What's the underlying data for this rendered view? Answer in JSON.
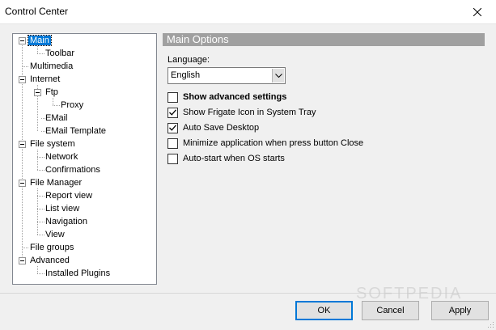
{
  "window": {
    "title": "Control Center"
  },
  "tree": {
    "items": [
      {
        "label": "Main",
        "selected": true
      },
      {
        "label": "Toolbar"
      },
      {
        "label": "Multimedia"
      },
      {
        "label": "Internet"
      },
      {
        "label": "Ftp"
      },
      {
        "label": "Proxy"
      },
      {
        "label": "EMail"
      },
      {
        "label": "EMail Template"
      },
      {
        "label": "File system"
      },
      {
        "label": "Network"
      },
      {
        "label": "Confirmations"
      },
      {
        "label": "File Manager"
      },
      {
        "label": "Report view"
      },
      {
        "label": "List view"
      },
      {
        "label": "Navigation"
      },
      {
        "label": "View"
      },
      {
        "label": "File groups"
      },
      {
        "label": "Advanced"
      },
      {
        "label": "Installed Plugins"
      }
    ]
  },
  "panel": {
    "header": "Main Options",
    "language_label": "Language:",
    "language_value": "English",
    "options": [
      {
        "label": "Show advanced settings",
        "checked": false,
        "bold": true
      },
      {
        "label": "Show Frigate Icon in System Tray",
        "checked": true
      },
      {
        "label": "Auto Save Desktop",
        "checked": true
      },
      {
        "label": "Minimize application when press button Close",
        "checked": false
      },
      {
        "label": "Auto-start when OS starts",
        "checked": false
      }
    ]
  },
  "buttons": {
    "ok": "OK",
    "cancel": "Cancel",
    "apply": "Apply"
  },
  "watermark": "SOFTPEDIA",
  "colors": {
    "selection": "#0078d7",
    "panel_header": "#a0a0a0"
  }
}
